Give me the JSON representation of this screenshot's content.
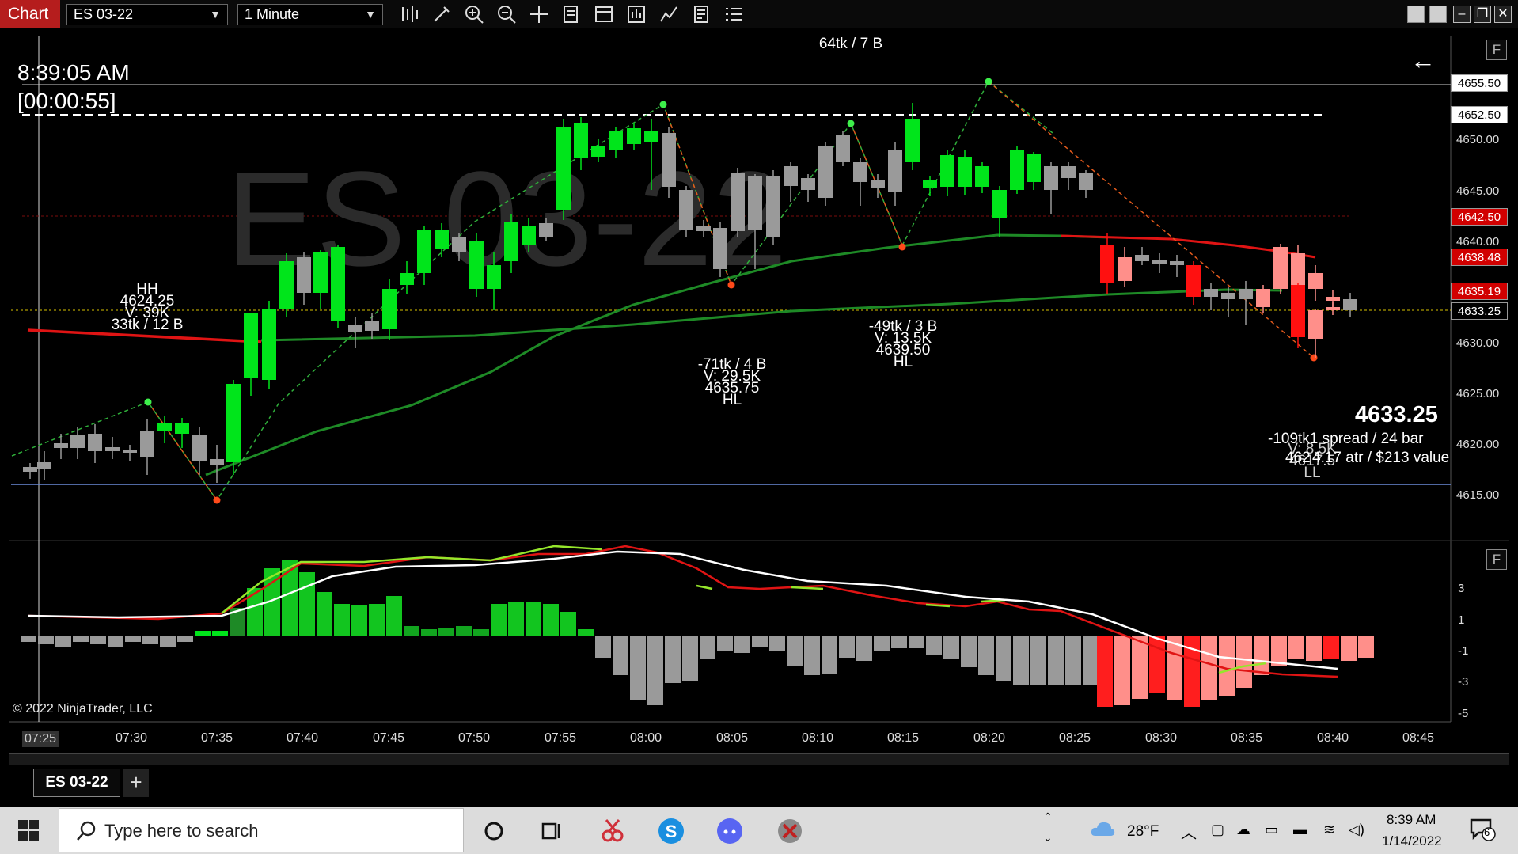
{
  "toolbar": {
    "app_tab": "Chart",
    "instrument": "ES 03-22",
    "interval": "1 Minute",
    "icons": [
      "bar-type-icon",
      "draw-pencil-icon",
      "zoom-in-icon",
      "zoom-out-icon",
      "crosshair-icon",
      "properties-icon",
      "template-icon",
      "indicators-icon",
      "strategies-icon",
      "data-box-icon",
      "menu-list-icon"
    ]
  },
  "chart": {
    "watermark": "ES 03-22",
    "clock_time": "8:39:05 AM",
    "bar_timer": "[00:00:55]",
    "copyright": "© 2022 NinjaTrader, LLC",
    "panel_button": "F",
    "back_arrow": "←",
    "price_axis_labels": [
      "4650.00",
      "4645.00",
      "4640.00",
      "4630.00",
      "4625.00",
      "4620.00",
      "4615.00"
    ],
    "price_boxes": [
      {
        "value": "4655.50",
        "bg": "#ffffff",
        "fg": "#000000"
      },
      {
        "value": "4652.50",
        "bg": "#ffffff",
        "fg": "#000000"
      },
      {
        "value": "4642.50",
        "bg": "#d10000",
        "fg": "#ffffff"
      },
      {
        "value": "4638.48",
        "bg": "#d10000",
        "fg": "#ffffff"
      },
      {
        "value": "4635.19",
        "bg": "#d10000",
        "fg": "#ffffff"
      },
      {
        "value": "4633.25",
        "bg": "#000000",
        "fg": "#ffffff"
      }
    ],
    "osc_axis_labels": [
      "3",
      "1",
      "-1",
      "-3",
      "-5"
    ],
    "time_labels": [
      "07:25",
      "07:30",
      "07:35",
      "07:40",
      "07:45",
      "07:50",
      "07:55",
      "08:00",
      "08:05",
      "08:10",
      "08:15",
      "08:20",
      "08:25",
      "08:30",
      "08:35",
      "08:40",
      "08:45"
    ],
    "annotations": {
      "top": "64tk / 7 B",
      "hh": [
        "HH",
        "4624.25",
        "V: 39K",
        "33tk / 12 B"
      ],
      "hl1": [
        "-71tk / 4 B",
        "V: 29.5K",
        "4635.75",
        "HL"
      ],
      "hl2": [
        "-49tk / 3 B",
        "V: 13.5K",
        "4639.50",
        "HL"
      ],
      "ll": [
        "V: 8.5K",
        "4617.5",
        "LL"
      ]
    },
    "last_price": "4633.25",
    "info_line1": "-109tk1 spread / 24 bar",
    "info_line2": "4.17 atr / $213 value",
    "info_prefix2": "462",
    "colors": {
      "up": "#00e51b",
      "down": "#ff1010",
      "neutral": "#9a9a9a",
      "ma_green": "#1e8a26",
      "ma_red": "#e01414",
      "light_down": "#ff8f8a"
    }
  },
  "bottom_tabs": {
    "active": "ES 03-22",
    "add": "+"
  },
  "taskbar": {
    "search_placeholder": "Type here to search",
    "weather": "28°F",
    "time": "8:39 AM",
    "date": "1/14/2022",
    "notifications": "6"
  }
}
